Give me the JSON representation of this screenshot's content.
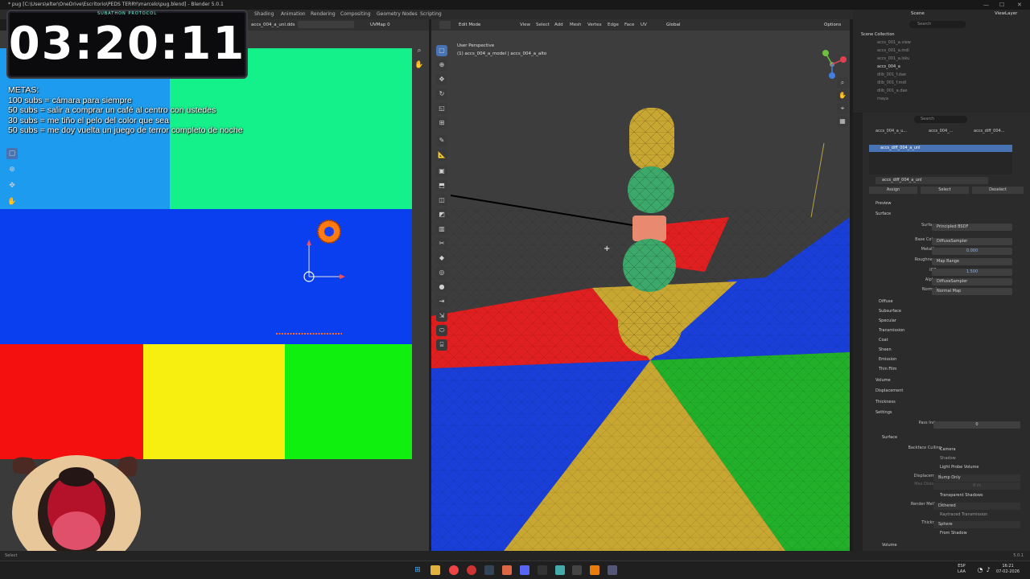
{
  "window": {
    "title": "* pug [C:\\Users\\elter\\OneDrive\\Escritorio\\PEDS TERRY\\marcelo\\pug.blend] - Blender 5.0.1"
  },
  "workspace_tabs": [
    "Shading",
    "Animation",
    "Rendering",
    "Compositing",
    "Geometry Nodes",
    "Scripting"
  ],
  "uv_editor": {
    "image_name": "accs_004_a_unl.dds",
    "uvmap": "UVMap 0"
  },
  "timer": {
    "value": "03:20:11",
    "label": "SUBATHON PROTOCOL"
  },
  "goals": {
    "title": "METAS:",
    "items": [
      "100 subs = cámara para siempre",
      "50 subs = salir a comprar un café al centro con ustedes",
      "30 subs = me tiño el pelo del color que sea",
      "50 subs = me doy vuelta un juego de terror completo de noche"
    ]
  },
  "viewport": {
    "mode": "Edit Mode",
    "menus": [
      "View",
      "Select",
      "Add",
      "Mesh",
      "Vertex",
      "Edge",
      "Face",
      "UV"
    ],
    "orientation": "Global",
    "options_label": "Options",
    "view_name": "User Perspective",
    "object_info": "(1) accs_004_a_model | accs_004_a_alto"
  },
  "scene": {
    "scene_label": "Scene",
    "view_layer": "ViewLayer",
    "search_placeholder": "Search"
  },
  "outliner": {
    "collection": "Scene Collection",
    "items": [
      "accs_001_a.view",
      "accs_001_a.mdl",
      "accs_001_a.lsku",
      "accs_004_a",
      "dlib_001_f.dae",
      "dlib_001_f.mdl",
      "dlib_001_a.dae",
      "maya"
    ]
  },
  "properties": {
    "breadcrumb": [
      "accs_004_a_u...",
      "accs_004_...",
      "accs_diff_004..."
    ],
    "slot": "accs_diff_004_a_unl",
    "material": "accs_diff_004_a_unl",
    "buttons": [
      "Assign",
      "Select",
      "Deselect"
    ],
    "sections": {
      "preview": "Preview",
      "surface": "Surface"
    },
    "inputs": [
      {
        "label": "Surface",
        "value": "Principled BSDF"
      },
      {
        "label": "Base Color",
        "value": "DiffuseSampler"
      },
      {
        "label": "Metallic",
        "value": "0.000"
      },
      {
        "label": "Roughness",
        "value": "Map Range"
      },
      {
        "label": "IOR",
        "value": "1.500"
      },
      {
        "label": "Alpha",
        "value": "DiffuseSampler"
      },
      {
        "label": "Normal",
        "value": "Normal Map"
      }
    ],
    "subsections": [
      "Diffuse",
      "Subsurface",
      "Specular",
      "Transmission",
      "Coat",
      "Sheen",
      "Emission",
      "Thin Film"
    ],
    "groups": [
      "Volume",
      "Displacement",
      "Thickness",
      "Settings"
    ],
    "settings": {
      "pass_index_label": "Pass Index",
      "pass_index": "0",
      "surface_label": "Surface",
      "backface_label": "Backface Culling",
      "backface_options": [
        "Camera",
        "Shadow",
        "Light Probe Volume"
      ],
      "displacement_label": "Displacement",
      "displacement": "Bump Only",
      "max_distance_label": "Max Distance",
      "max_distance": "0 m",
      "transparent_shadows": "Transparent Shadows",
      "render_method_label": "Render Method",
      "render_method": "Dithered",
      "raytraced": "Raytraced Transmission",
      "thickness_label": "Thickness",
      "thickness": "Sphere",
      "from_shadow": "From Shadow",
      "volume": "Volume"
    }
  },
  "status": {
    "left": "Select",
    "version": "5.0.1"
  },
  "taskbar": {
    "lang": "ESP\nLAA",
    "lang1": "ESP",
    "lang2": "LAA",
    "time": "16:21",
    "date": "07-02-2026"
  }
}
